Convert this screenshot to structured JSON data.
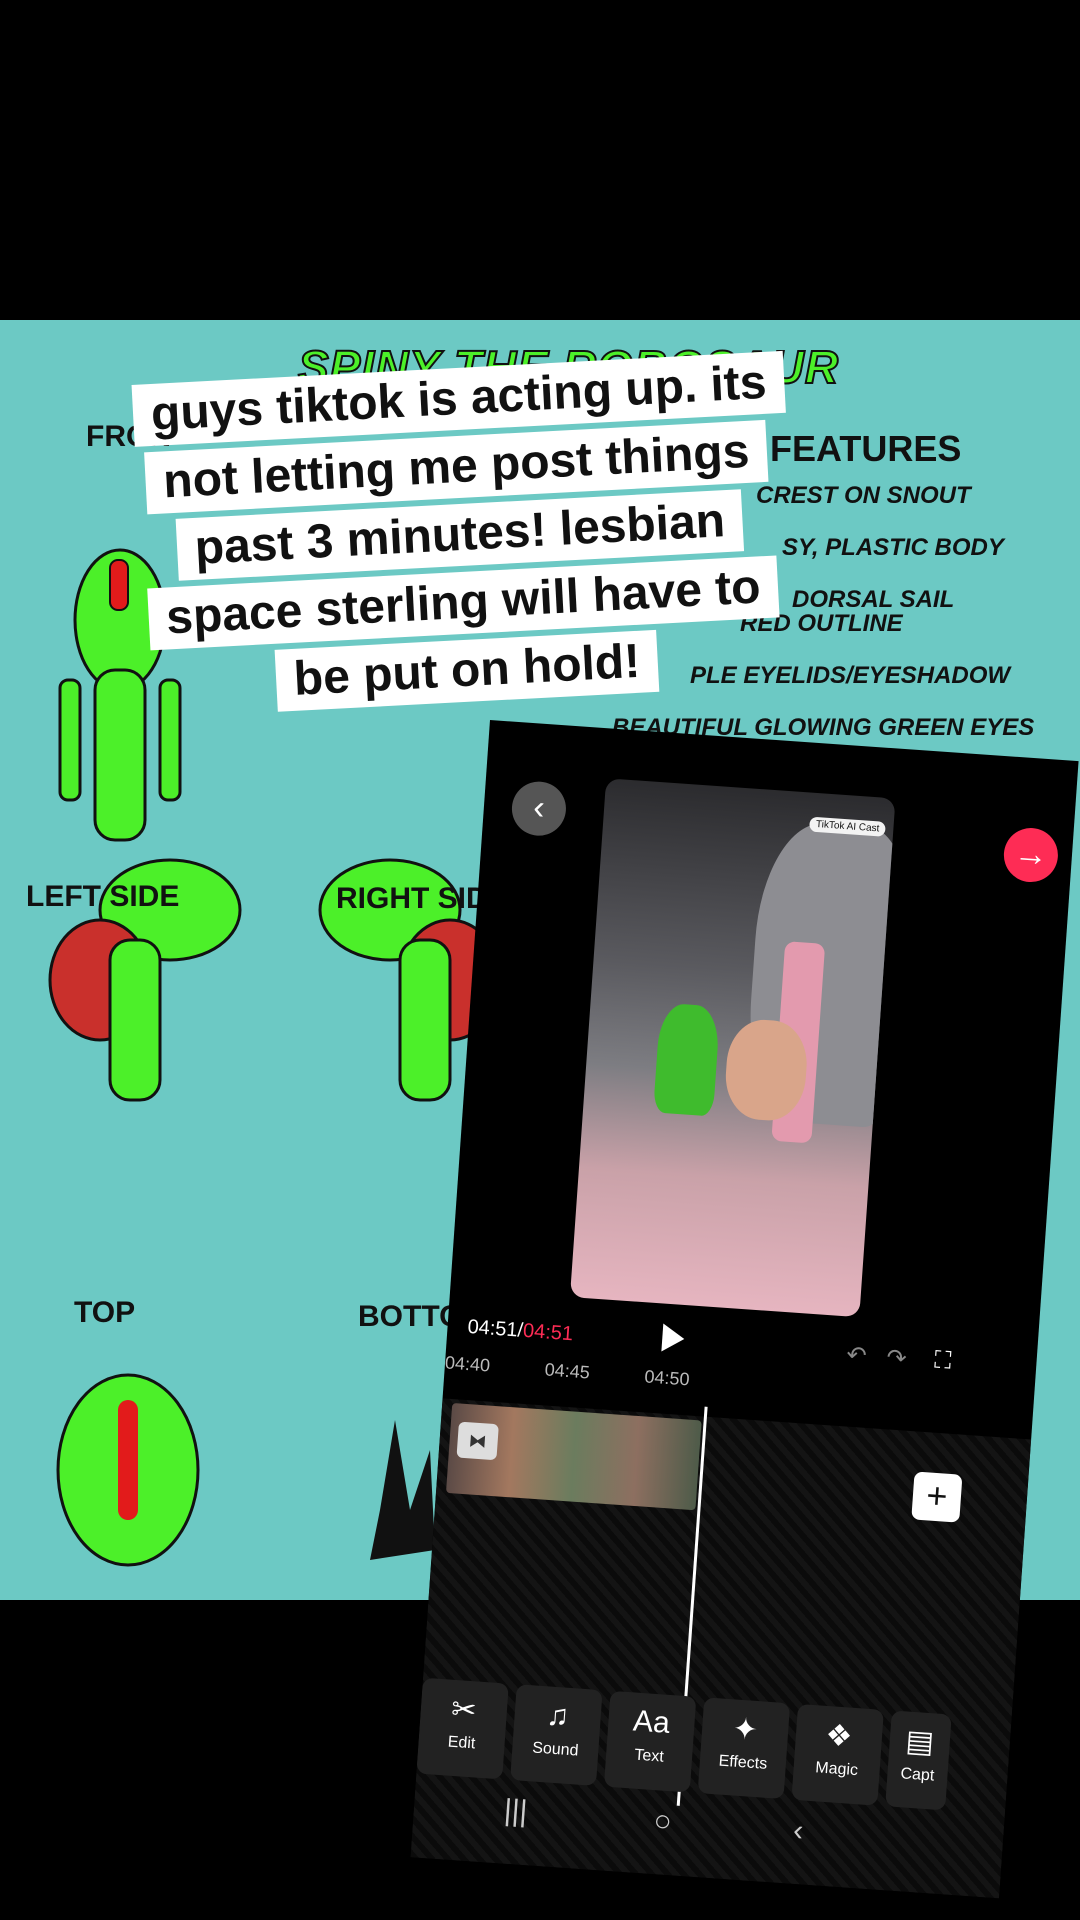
{
  "caption": {
    "lines": [
      "guys tiktok is acting up. its",
      "not letting me post things",
      "past 3 minutes! lesbian",
      "space sterling will have to",
      "be put on hold!"
    ]
  },
  "sheet": {
    "title": "SPINY THE ROBOSAUR",
    "features_title": "FEATURES",
    "features": [
      "CREST ON SNOUT",
      "SY, PLASTIC BODY",
      "DORSAL SAIL",
      "RED OUTLINE",
      "PLE EYELIDS/EYESHADOW",
      "BEAUTIFUL GLOWING GREEN EYES"
    ],
    "views": {
      "front": "FRON",
      "left": "LEFT SIDE",
      "right": "RIGHT SIDE",
      "top": "TOP",
      "bottom": "BOTTOM"
    }
  },
  "editor": {
    "back_icon": "chevron-left-icon",
    "next_icon": "arrow-right-icon",
    "watermark": "TikTok AI Cast",
    "current_time": "04:51",
    "total_time": "04:51",
    "ruler": [
      "04:40",
      "04:45",
      "04:50"
    ],
    "tools": [
      {
        "icon": "scissors-icon",
        "glyph": "✂",
        "label": "Edit"
      },
      {
        "icon": "music-note-icon",
        "glyph": "♫",
        "label": "Sound"
      },
      {
        "icon": "text-icon",
        "glyph": "Aa",
        "label": "Text"
      },
      {
        "icon": "sparkle-icon",
        "glyph": "✦",
        "label": "Effects"
      },
      {
        "icon": "magic-icon",
        "glyph": "❖",
        "label": "Magic"
      },
      {
        "icon": "captions-icon",
        "glyph": "▤",
        "label": "Capt"
      }
    ]
  },
  "colors": {
    "sheet_bg": "#6cc9c4",
    "accent_red": "#fe2c55",
    "dino_green": "#4cf029"
  }
}
